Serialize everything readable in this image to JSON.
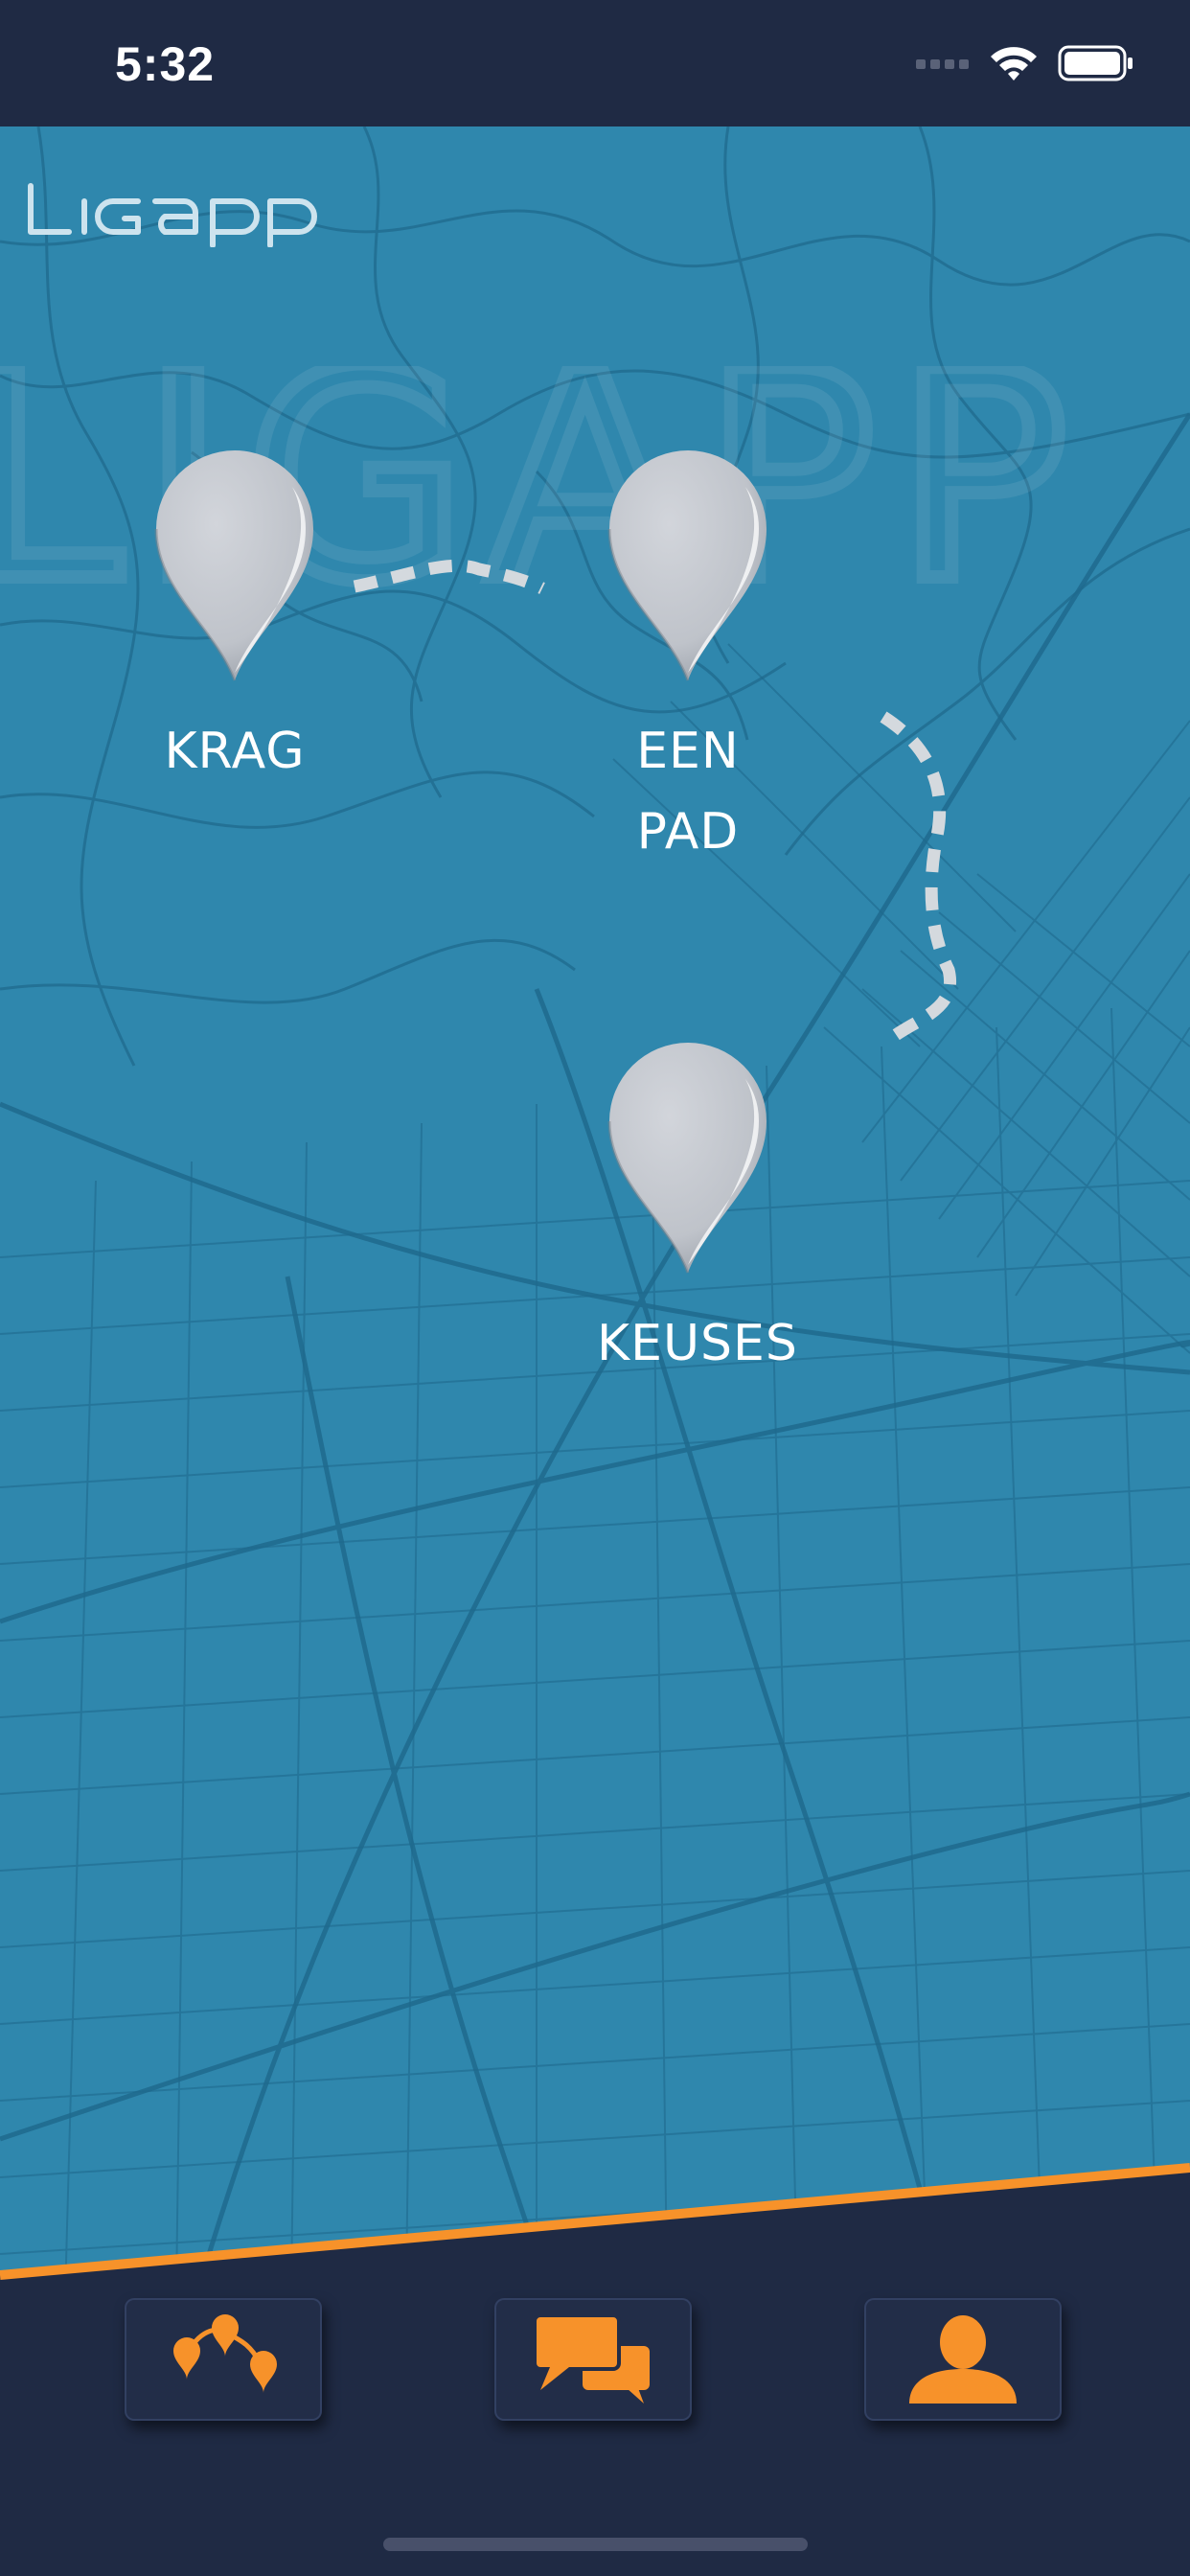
{
  "status_bar": {
    "time": "5:32",
    "icons": [
      "cellular-signal-icon",
      "wifi-icon",
      "battery-icon"
    ]
  },
  "app": {
    "logo_text": "LIGAPP"
  },
  "pins": [
    {
      "id": "krag",
      "line1": "KRAG",
      "line2": ""
    },
    {
      "id": "een-pad",
      "line1": "EEN",
      "line2": "PAD"
    },
    {
      "id": "keuses",
      "line1": "KEUSES",
      "line2": ""
    }
  ],
  "nav": {
    "items": [
      {
        "id": "journey",
        "icon": "route-pins-icon"
      },
      {
        "id": "chat",
        "icon": "chat-bubbles-icon"
      },
      {
        "id": "profile",
        "icon": "user-icon"
      }
    ]
  },
  "colors": {
    "map_background": "#2f87ad",
    "map_roads": "#1f6a8e",
    "nav_background": "#1f2a44",
    "accent": "#f7922a",
    "pin": "#c2c5cc",
    "dash": "#d4d9de"
  }
}
